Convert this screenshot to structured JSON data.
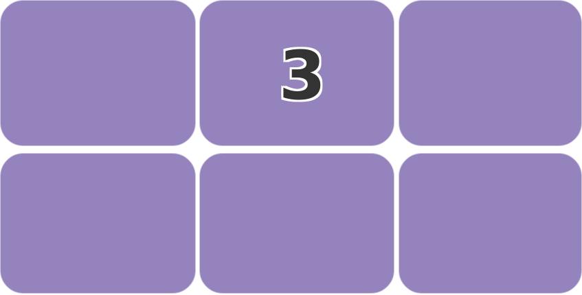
{
  "board": {
    "tile_color": "#9583bd",
    "label_color": "#333333",
    "tiles": [
      {
        "label": ""
      },
      {
        "label": "3"
      },
      {
        "label": ""
      },
      {
        "label": ""
      },
      {
        "label": ""
      },
      {
        "label": ""
      }
    ]
  }
}
